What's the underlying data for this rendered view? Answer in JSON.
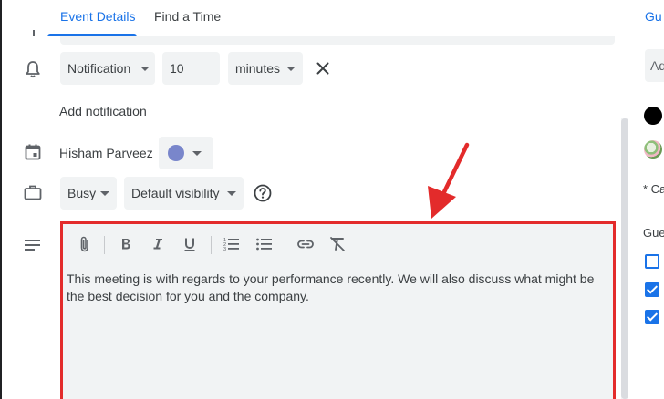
{
  "tabs": {
    "event_details": "Event Details",
    "find_a_time": "Find a Time"
  },
  "notification": {
    "type": "Notification",
    "value": "10",
    "unit": "minutes",
    "add_label": "Add notification"
  },
  "calendar": {
    "owner": "Hisham Parveez",
    "color": "#7986cb"
  },
  "availability": {
    "status": "Busy",
    "visibility": "Default visibility"
  },
  "description": {
    "text": "This meeting is with regards to your performance recently. We will also discuss what might be the best decision for you and the company."
  },
  "right_panel": {
    "tab_partial": "Gu",
    "input_partial": "Ad",
    "note_partial": "* Ca",
    "guests_partial": "Gue",
    "checkboxes": [
      false,
      true,
      true
    ]
  },
  "icons": {
    "notification": "bell-icon",
    "calendar": "calendar-icon",
    "availability": "briefcase-icon",
    "description": "notes-icon",
    "help": "help-icon",
    "remove": "close-icon"
  },
  "colors": {
    "accent": "#1a73e8",
    "highlight_border": "#e32b2b",
    "field_bg": "#f1f3f4"
  }
}
